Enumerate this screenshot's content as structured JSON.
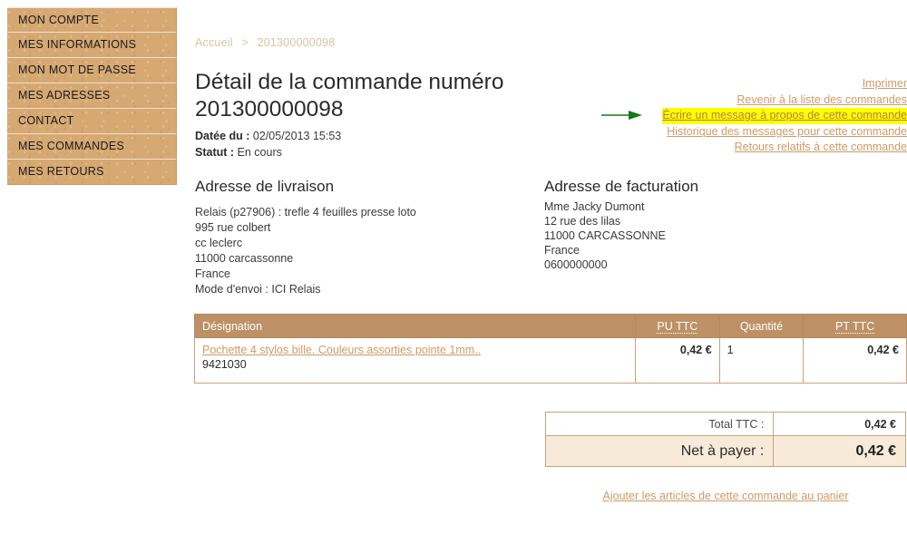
{
  "sidebar": {
    "items": [
      {
        "label": "MON COMPTE"
      },
      {
        "label": "MES INFORMATIONS"
      },
      {
        "label": "MON MOT DE PASSE"
      },
      {
        "label": "MES ADRESSES"
      },
      {
        "label": "CONTACT"
      },
      {
        "label": "MES COMMANDES"
      },
      {
        "label": "MES RETOURS"
      }
    ]
  },
  "breadcrumb": {
    "home": "Accueil",
    "separator": ">",
    "current": "201300000098"
  },
  "page": {
    "title": "Détail de la commande numéro 201300000098",
    "date_label": "Datée du :",
    "date_value": "02/05/2013 15:53",
    "status_label": "Statut :",
    "status_value": "En cours"
  },
  "actions": {
    "items": [
      {
        "label": "Imprimer",
        "highlighted": false
      },
      {
        "label": "Revenir à la liste des commandes",
        "highlighted": false
      },
      {
        "label": "Écrire un message à propos de cette commande",
        "highlighted": true
      },
      {
        "label": "Historique des messages pour cette commande",
        "highlighted": false
      },
      {
        "label": "Retours relatifs à cette commande",
        "highlighted": false
      }
    ],
    "highlight_color": "#ffff00",
    "link_color": "#cf9b67",
    "arrow_color": "#157a15"
  },
  "shipping_address": {
    "heading": "Adresse de livraison",
    "lines": [
      "Relais (p27906) : trefle 4 feuilles presse loto",
      "995 rue colbert",
      "cc leclerc",
      "11000 carcassonne",
      "France",
      "Mode d'envoi : ICI Relais"
    ]
  },
  "billing_address": {
    "heading": "Adresse de facturation",
    "lines": [
      "Mme Jacky Dumont",
      "12 rue des lilas",
      "11000 CARCASSONNE",
      "France",
      "0600000000"
    ]
  },
  "items_table": {
    "headers": {
      "designation": "Désignation",
      "unit_price": "PU TTC",
      "quantity": "Quantité",
      "total_price": "PT TTC"
    },
    "rows": [
      {
        "designation": "Pochette 4 stylos bille. Couleurs assorties pointe 1mm..",
        "sku": "9421030",
        "unit_price": "0,42 €",
        "quantity": "1",
        "total_price": "0,42 €"
      }
    ]
  },
  "totals": {
    "total_label": "Total TTC :",
    "total_value": "0,42 €",
    "net_label": "Net à payer :",
    "net_value": "0,42 €"
  },
  "cart": {
    "link_label": "Ajouter les articles de cette commande au panier"
  }
}
